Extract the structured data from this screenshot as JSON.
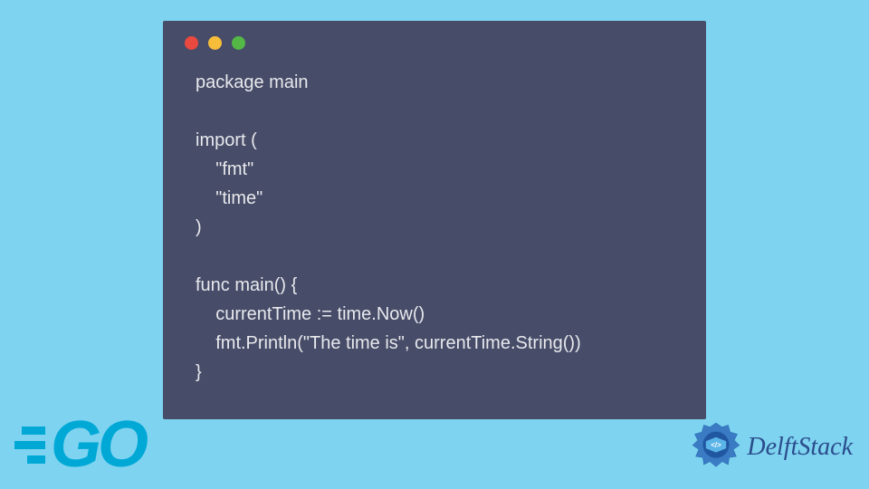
{
  "code": {
    "lines": [
      "package main",
      "",
      "import (",
      "    \"fmt\"",
      "    \"time\"",
      ")",
      "",
      "func main() {",
      "    currentTime := time.Now()",
      "    fmt.Println(\"The time is\", currentTime.String())",
      "}"
    ]
  },
  "logos": {
    "go_text": "GO",
    "delft_text": "DelftStack"
  },
  "colors": {
    "background": "#7DD3F0",
    "code_window": "#474C68",
    "code_text": "#E8E9ED",
    "go_brand": "#00A8D6",
    "delft_brand": "#2B4C8C",
    "traffic_red": "#E9493F",
    "traffic_yellow": "#F6BD3B",
    "traffic_green": "#54B847"
  }
}
